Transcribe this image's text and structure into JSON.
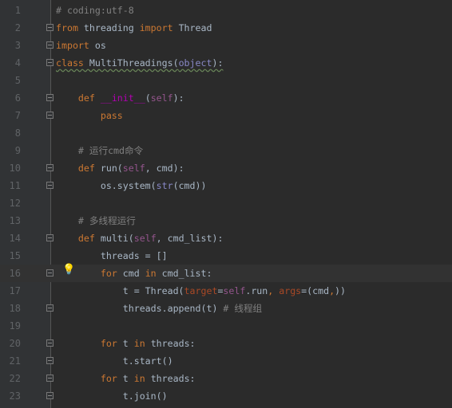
{
  "editor": {
    "current_line": 16,
    "lines": [
      {
        "n": "1",
        "tokens": [
          [
            "# coding:utf-8",
            "cm"
          ]
        ]
      },
      {
        "n": "2",
        "fold": true,
        "tokens": [
          [
            "from",
            "kw"
          ],
          [
            " threading ",
            ""
          ],
          [
            "import",
            "kw"
          ],
          [
            " Thread",
            ""
          ]
        ]
      },
      {
        "n": "3",
        "fold": true,
        "tokens": [
          [
            "import",
            "kw"
          ],
          [
            " os",
            ""
          ]
        ]
      },
      {
        "n": "4",
        "fold": true,
        "wavy": true,
        "tokens": [
          [
            "class",
            "kw"
          ],
          [
            " MultiThreadings(",
            ""
          ],
          [
            "object",
            "ob"
          ],
          [
            "):",
            ""
          ]
        ]
      },
      {
        "n": "5",
        "tokens": []
      },
      {
        "n": "6",
        "fold": true,
        "tokens": [
          [
            "    ",
            ""
          ],
          [
            "def",
            "kw"
          ],
          [
            " ",
            ""
          ],
          [
            "__init__",
            "mg"
          ],
          [
            "(",
            ""
          ],
          [
            "self",
            "sf"
          ],
          [
            "):",
            ""
          ]
        ]
      },
      {
        "n": "7",
        "fold": true,
        "tokens": [
          [
            "        ",
            ""
          ],
          [
            "pass",
            "kw"
          ]
        ]
      },
      {
        "n": "8",
        "tokens": []
      },
      {
        "n": "9",
        "tokens": [
          [
            "    ",
            ""
          ],
          [
            "# 运行cmd命令",
            "cm"
          ]
        ]
      },
      {
        "n": "10",
        "fold": true,
        "tokens": [
          [
            "    ",
            ""
          ],
          [
            "def",
            "kw"
          ],
          [
            " run(",
            ""
          ],
          [
            "self",
            "sf"
          ],
          [
            ", cmd):",
            ""
          ]
        ]
      },
      {
        "n": "11",
        "fold": true,
        "tokens": [
          [
            "        os.system(",
            ""
          ],
          [
            "str",
            "ob"
          ],
          [
            "(cmd))",
            ""
          ]
        ]
      },
      {
        "n": "12",
        "tokens": []
      },
      {
        "n": "13",
        "tokens": [
          [
            "    ",
            ""
          ],
          [
            "# 多线程运行",
            "cm"
          ]
        ]
      },
      {
        "n": "14",
        "fold": true,
        "tokens": [
          [
            "    ",
            ""
          ],
          [
            "def",
            "kw"
          ],
          [
            " multi(",
            ""
          ],
          [
            "self",
            "sf"
          ],
          [
            ", cmd_list):",
            ""
          ]
        ]
      },
      {
        "n": "15",
        "tokens": [
          [
            "        threads = []",
            ""
          ]
        ]
      },
      {
        "n": "16",
        "fold": true,
        "tokens": [
          [
            "        ",
            ""
          ],
          [
            "for",
            "kw"
          ],
          [
            " cmd ",
            ""
          ],
          [
            "in",
            "kw"
          ],
          [
            " cmd_list:",
            ""
          ]
        ]
      },
      {
        "n": "17",
        "tokens": [
          [
            "            t = Thread(",
            ""
          ],
          [
            "target",
            "pa"
          ],
          [
            "=",
            ""
          ],
          [
            "self",
            "sf"
          ],
          [
            ".run",
            ""
          ],
          [
            ",",
            "kw"
          ],
          [
            " ",
            ""
          ],
          [
            "args",
            "pa"
          ],
          [
            "=(cmd",
            ""
          ],
          [
            ",",
            "kw"
          ],
          [
            "))",
            ""
          ]
        ]
      },
      {
        "n": "18",
        "fold": true,
        "tokens": [
          [
            "            threads.append(t) ",
            ""
          ],
          [
            "# 线程组",
            "cm"
          ]
        ]
      },
      {
        "n": "19",
        "tokens": []
      },
      {
        "n": "20",
        "fold": true,
        "tokens": [
          [
            "        ",
            ""
          ],
          [
            "for",
            "kw"
          ],
          [
            " t ",
            ""
          ],
          [
            "in",
            "kw"
          ],
          [
            " threads:",
            ""
          ]
        ]
      },
      {
        "n": "21",
        "fold": true,
        "tokens": [
          [
            "            t.start()",
            ""
          ]
        ]
      },
      {
        "n": "22",
        "fold": true,
        "tokens": [
          [
            "        ",
            ""
          ],
          [
            "for",
            "kw"
          ],
          [
            " t ",
            ""
          ],
          [
            "in",
            "kw"
          ],
          [
            " threads:",
            ""
          ]
        ]
      },
      {
        "n": "23",
        "fold": true,
        "tokens": [
          [
            "            t.join()",
            ""
          ]
        ]
      }
    ],
    "intention_icon": "lightbulb-icon"
  }
}
